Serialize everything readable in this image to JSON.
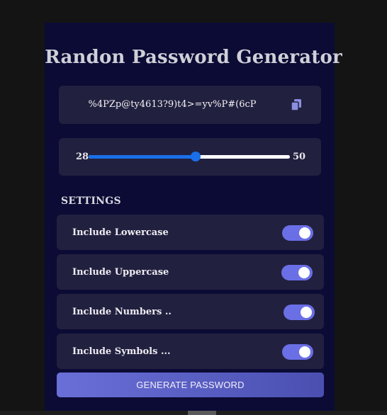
{
  "app": {
    "title": "Randon Password Generator"
  },
  "password": {
    "value": "%4PZp@ty4613?9)t4>=yv%P#(6cP",
    "copy_icon": "copy-icon"
  },
  "length_slider": {
    "min": "28",
    "max": "50",
    "value_fraction": 0.53
  },
  "settings": {
    "label": "SETTINGS",
    "items": [
      {
        "label": "Include Lowercase",
        "on": true
      },
      {
        "label": "Include Uppercase",
        "on": true
      },
      {
        "label": "Include Numbers ..",
        "on": true
      },
      {
        "label": "Include Symbols ...",
        "on": true
      }
    ]
  },
  "generate_button": {
    "label": "GENERATE PASSWORD"
  },
  "colors": {
    "page_bg": "#141414",
    "card_bg": "#0b0b35",
    "panel_bg": "#22203f",
    "accent_slider": "#1a6fe8",
    "toggle_on": "#6a6fe6"
  }
}
